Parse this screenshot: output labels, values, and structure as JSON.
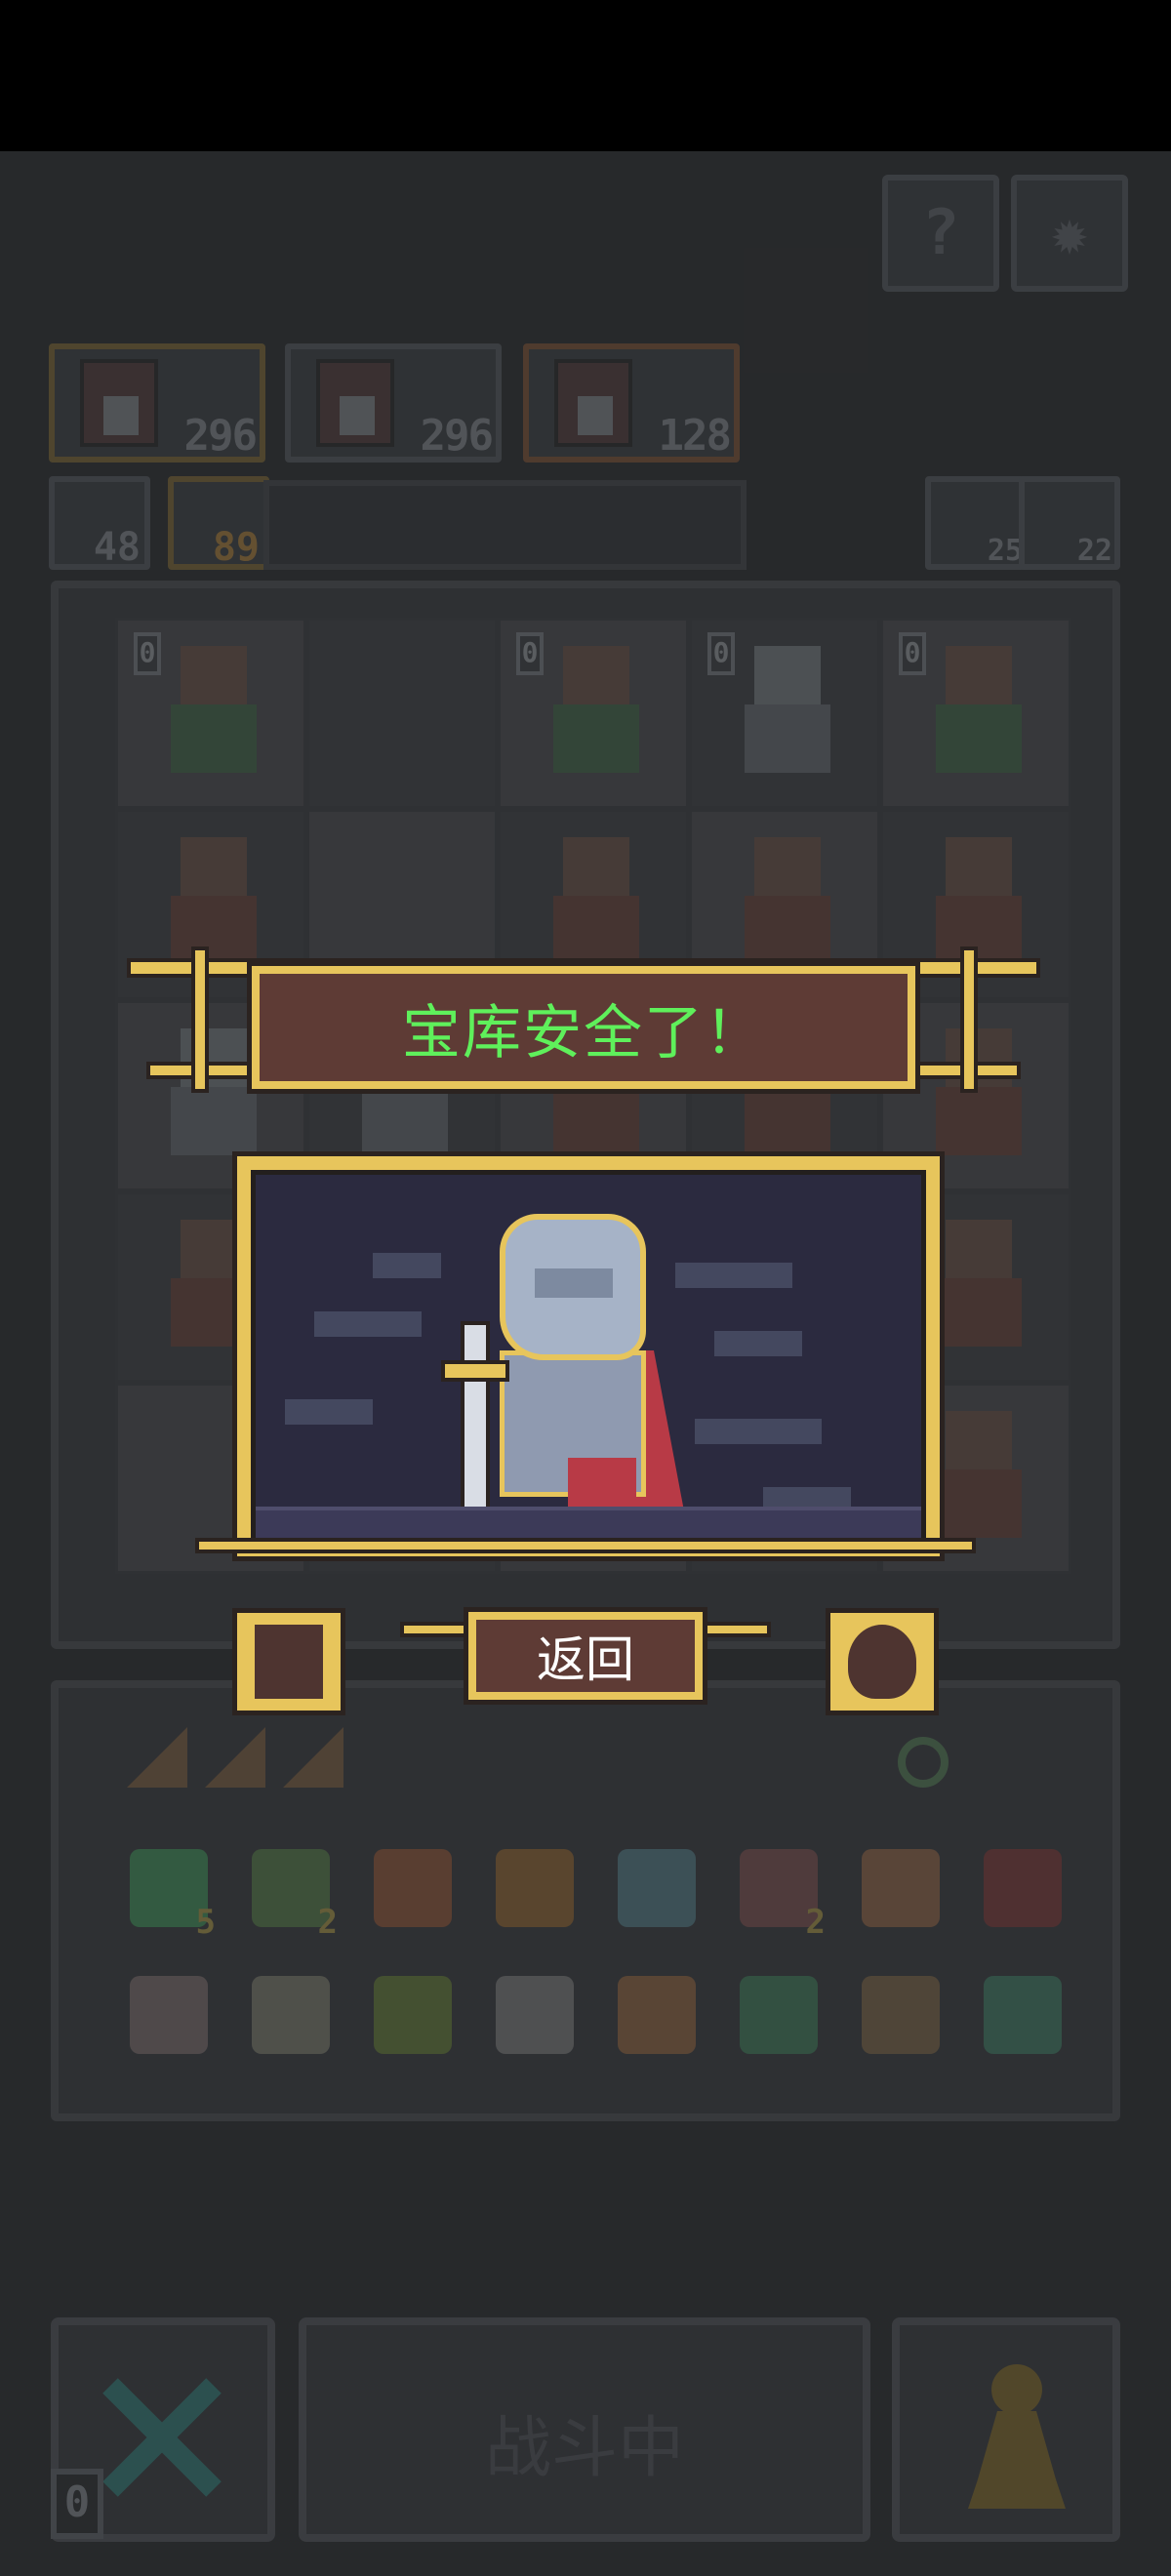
{
  "top_buttons": {
    "help_icon": "question-icon",
    "settings_icon": "gear-icon"
  },
  "heroes": [
    {
      "count": "296",
      "frame": "gold"
    },
    {
      "count": "296",
      "frame": "gray"
    },
    {
      "count": "128",
      "frame": "copper"
    }
  ],
  "resources": {
    "key_count": "48",
    "fox_count": "89"
  },
  "side_counters": {
    "undo": "25",
    "units": "22"
  },
  "board": {
    "level_badge": "0",
    "rows": [
      [
        "green",
        "empty",
        "green",
        "gray",
        "green"
      ],
      [
        "red",
        "empty",
        "red",
        "red",
        "red"
      ],
      [
        "gray",
        "gray",
        "red",
        "red",
        "red"
      ],
      [
        "red",
        "empty",
        "empty",
        "empty",
        "red"
      ],
      [
        "empty",
        "empty",
        "empty",
        "empty",
        "red"
      ]
    ]
  },
  "tray_items": [
    {
      "icon": "gem-shield-icon",
      "color": "#3f7a52",
      "count": "5"
    },
    {
      "icon": "goblin-icon",
      "color": "#4f6b45",
      "count": "2"
    },
    {
      "icon": "shield-icon",
      "color": "#7a4f3a",
      "count": ""
    },
    {
      "icon": "flower-icon",
      "color": "#7a5a35",
      "count": ""
    },
    {
      "icon": "portrait-icon",
      "color": "#4d6a72",
      "count": ""
    },
    {
      "icon": "sword-icon",
      "color": "#6a4a4a",
      "count": "2"
    },
    {
      "icon": "claw-icon",
      "color": "#7a5a44",
      "count": ""
    },
    {
      "icon": "chest-icon",
      "color": "#6a3a3a",
      "count": ""
    },
    {
      "icon": "potion-icon",
      "color": "#6a6060",
      "count": ""
    },
    {
      "icon": "jar-icon",
      "color": "#6a6a60",
      "count": ""
    },
    {
      "icon": "bowl-icon",
      "color": "#5a6a3a",
      "count": ""
    },
    {
      "icon": "mushroom-icon",
      "color": "#6a6a6a",
      "count": ""
    },
    {
      "icon": "tail-icon",
      "color": "#7a5a40",
      "count": ""
    },
    {
      "icon": "gate-icon",
      "color": "#3f6a52",
      "count": ""
    },
    {
      "icon": "scroll-icon",
      "color": "#6a5a44",
      "count": ""
    },
    {
      "icon": "orb-icon",
      "color": "#3f6a5a",
      "count": ""
    }
  ],
  "popup": {
    "title": "宝库安全了！",
    "back_label": "返回"
  },
  "bottom": {
    "battle_label": "战斗中",
    "badge": "0"
  }
}
